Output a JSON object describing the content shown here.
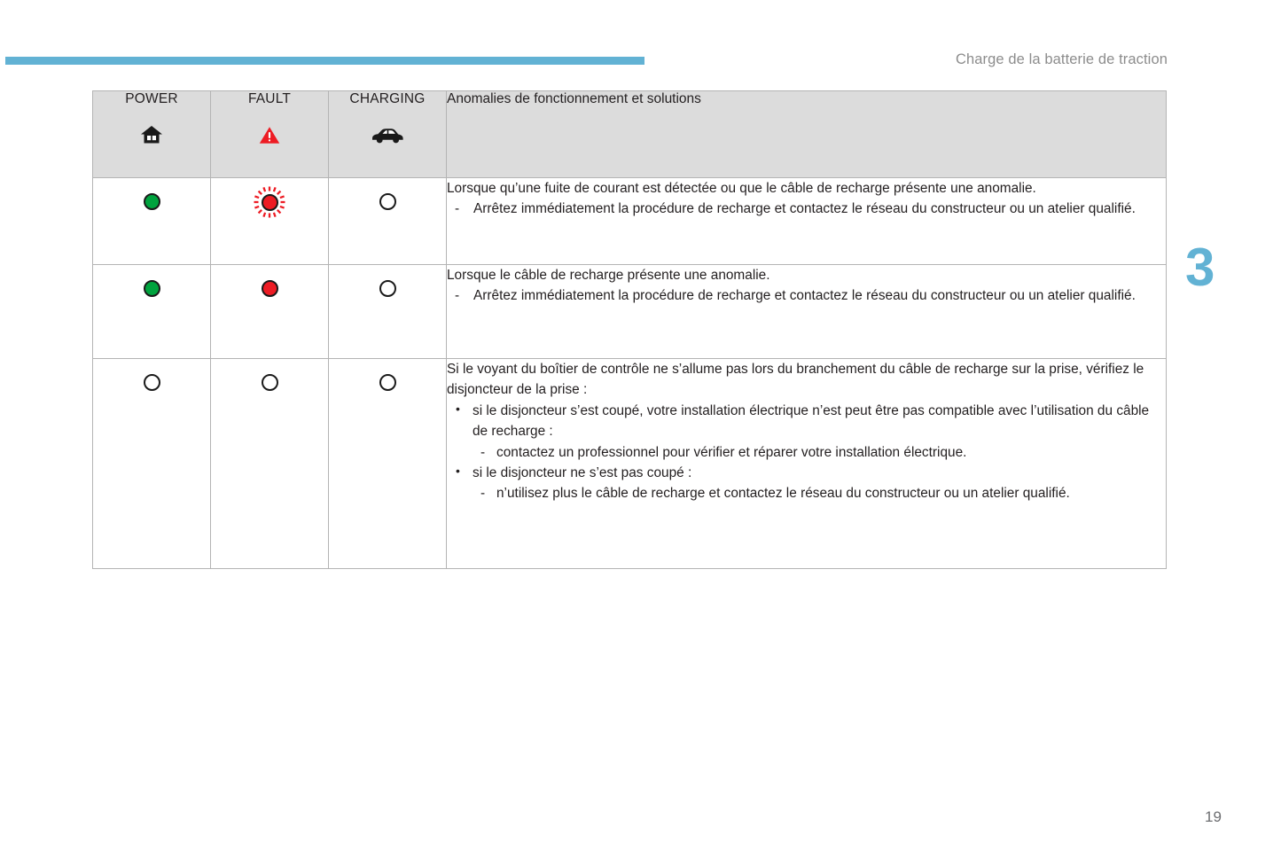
{
  "header": {
    "title": "Charge de la batterie de traction",
    "rule_color": "#62b2d4"
  },
  "chapter": {
    "number": "3",
    "color": "#62b2d4"
  },
  "page": {
    "number": "19"
  },
  "table": {
    "columns": [
      {
        "label": "POWER",
        "icon": "house-icon"
      },
      {
        "label": "FAULT",
        "icon": "warning-triangle-icon"
      },
      {
        "label": "CHARGING",
        "icon": "car-icon"
      },
      {
        "label": "Anomalies de fonctionnement et solutions",
        "icon": ""
      }
    ],
    "rows": [
      {
        "power": "green",
        "fault": "red-blinking",
        "charging": "off",
        "lead": "Lorsque qu’une fuite de courant est détectée ou que le câble de recharge présente une anomalie.",
        "dashes": [
          "Arrêtez immédiatement la procédure de recharge et contactez le réseau du constructeur ou un atelier qualifié."
        ]
      },
      {
        "power": "green",
        "fault": "red",
        "charging": "off",
        "lead": "Lorsque le câble de recharge présente une anomalie.",
        "dashes": [
          "Arrêtez immédiatement la procédure de recharge et contactez le réseau du constructeur ou un atelier qualifié."
        ]
      },
      {
        "power": "off",
        "fault": "off",
        "charging": "off",
        "lead": "Si le voyant du boîtier de contrôle ne s’allume pas lors du branchement du câble de recharge sur la prise, vérifiez le disjoncteur de la prise :",
        "bullets": [
          {
            "text": "si le disjoncteur s’est coupé, votre installation électrique n’est peut être pas compatible avec l’utilisation du câble de recharge :",
            "sub": [
              "contactez un professionnel pour vérifier et réparer votre installation électrique."
            ]
          },
          {
            "text": "si le disjoncteur ne s’est pas coupé :",
            "sub": [
              "n’utilisez plus le câble de recharge et contactez le réseau du constructeur ou un atelier qualifié."
            ]
          }
        ]
      }
    ]
  },
  "colors": {
    "lamp_green": "#00a33e",
    "lamp_red": "#ed1c24",
    "lamp_off": "#ffffff",
    "warning_red": "#ed1c24",
    "header_bg": "#dcdcdc"
  }
}
